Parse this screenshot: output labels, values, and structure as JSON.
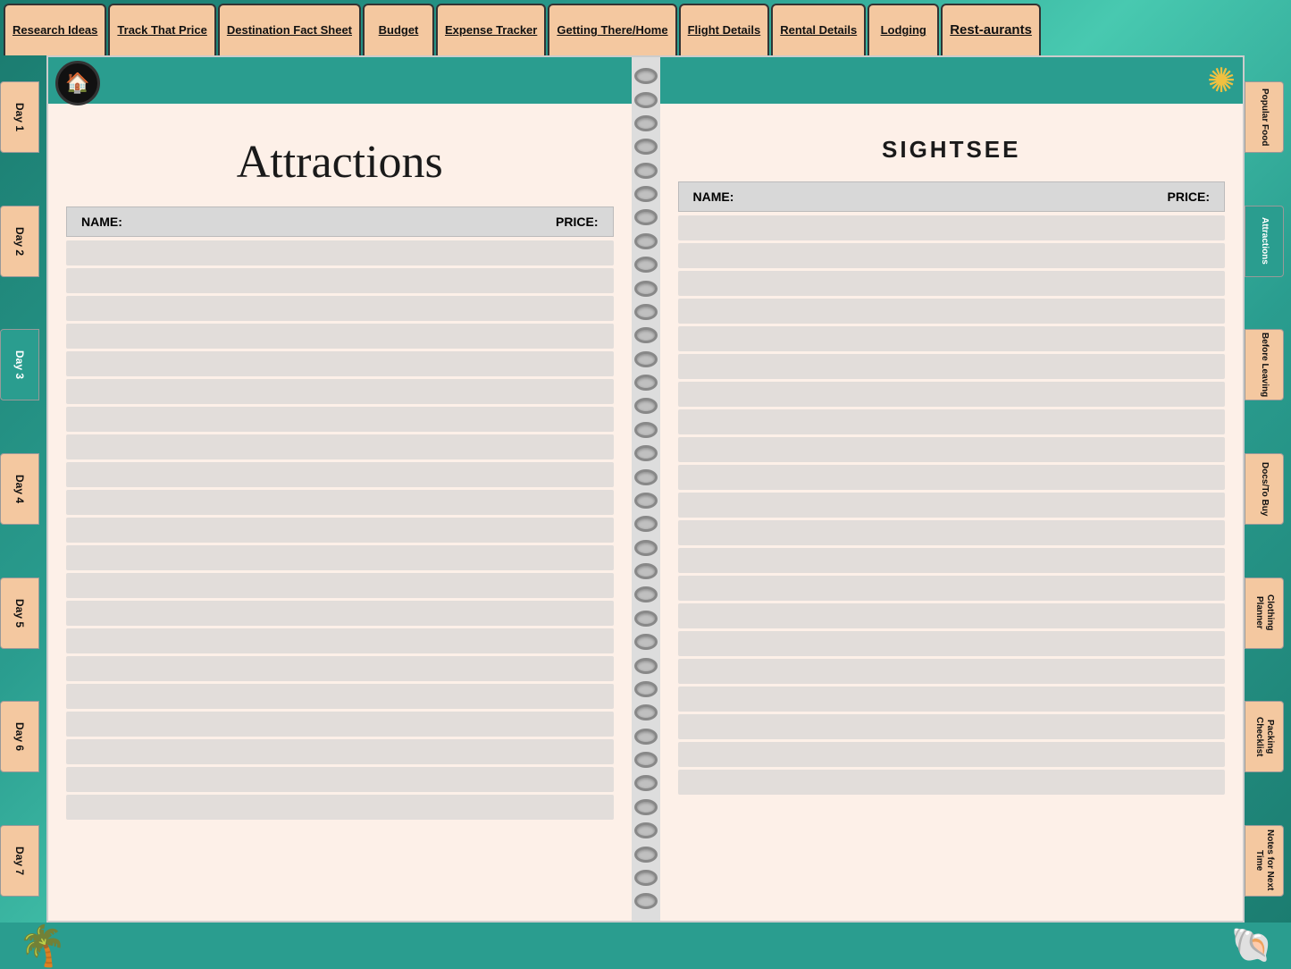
{
  "nav": {
    "tabs": [
      {
        "id": "research-ideas",
        "label": "Research Ideas",
        "underline": true
      },
      {
        "id": "track-that-price",
        "label": "Track That Price",
        "underline": true
      },
      {
        "id": "destination-fact-sheet",
        "label": "Destination Fact Sheet",
        "underline": true
      },
      {
        "id": "budget",
        "label": "Budget",
        "underline": true
      },
      {
        "id": "expense-tracker",
        "label": "Expense Tracker",
        "underline": true
      },
      {
        "id": "getting-there-home",
        "label": "Getting There/Home",
        "underline": true
      },
      {
        "id": "flight-details",
        "label": "Flight Details",
        "underline": true
      },
      {
        "id": "rental-details",
        "label": "Rental Details",
        "underline": true
      },
      {
        "id": "lodging",
        "label": "Lodging",
        "underline": true
      },
      {
        "id": "restaurants",
        "label": "Rest-aurants",
        "underline": true
      }
    ]
  },
  "left_tabs": [
    {
      "id": "day-1",
      "label": "Day 1",
      "teal": false
    },
    {
      "id": "day-2",
      "label": "Day 2",
      "teal": false
    },
    {
      "id": "day-3",
      "label": "Day 3",
      "teal": true
    },
    {
      "id": "day-4",
      "label": "Day 4",
      "teal": false
    },
    {
      "id": "day-5",
      "label": "Day 5",
      "teal": false
    },
    {
      "id": "day-6",
      "label": "Day 6",
      "teal": false
    },
    {
      "id": "day-7",
      "label": "Day 7",
      "teal": false
    }
  ],
  "right_tabs": [
    {
      "id": "popular-food",
      "label": "Popular Food",
      "teal": false
    },
    {
      "id": "attractions",
      "label": "Attractions",
      "teal": true
    },
    {
      "id": "before-leaving",
      "label": "Before Leaving",
      "teal": false
    },
    {
      "id": "docs-to-buy",
      "label": "Docs/To Buy",
      "teal": false
    },
    {
      "id": "clothing-planner",
      "label": "Clothing Planner",
      "teal": false
    },
    {
      "id": "packing-checklist",
      "label": "Packing Checklist",
      "teal": false
    },
    {
      "id": "notes-for-next-time",
      "label": "Notes for Next Time",
      "teal": false
    }
  ],
  "left_page": {
    "title": "Attractions",
    "table_header_name": "NAME:",
    "table_header_price": "PRICE:",
    "row_count": 21
  },
  "right_page": {
    "title": "SIGHTSEE",
    "table_header_name": "NAME:",
    "table_header_price": "PRICE:",
    "row_count": 21
  },
  "bottom": {
    "palm_icon": "🌴",
    "shell_icon": "🐚"
  },
  "home_icon": "🏠",
  "sun_icon": "☀"
}
